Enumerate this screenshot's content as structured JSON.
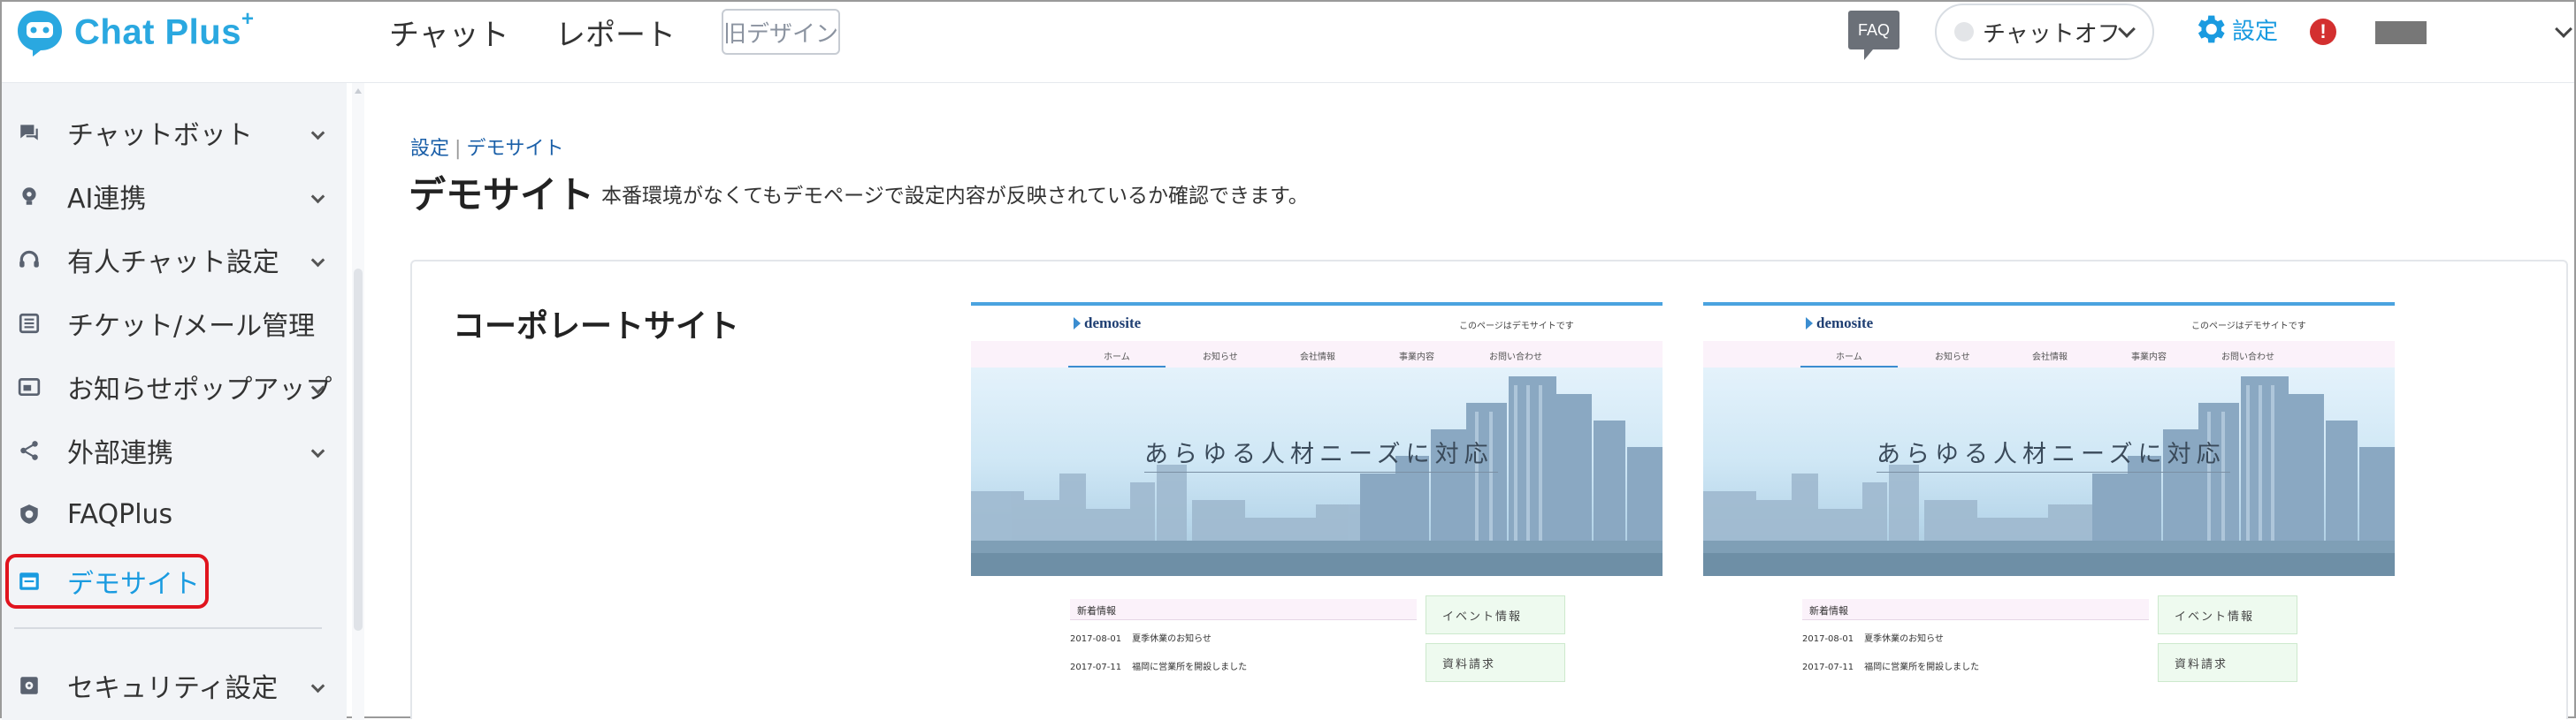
{
  "app": {
    "logo_text": "Chat Plus",
    "logo_sup": "+"
  },
  "topnav": {
    "items": [
      "チャット",
      "レポート"
    ],
    "old_design": "旧デザイン"
  },
  "header_right": {
    "faq_label": "FAQ",
    "chat_status": "チャットオフ",
    "settings_label": "設定",
    "alert_symbol": "!"
  },
  "sidebar": {
    "items": [
      {
        "label": "チャットボット",
        "icon": "chat-bubble-icon",
        "has_chevron": true
      },
      {
        "label": "AI連携",
        "icon": "lightbulb-icon",
        "has_chevron": true
      },
      {
        "label": "有人チャット設定",
        "icon": "headset-icon",
        "has_chevron": true
      },
      {
        "label": "チケット/メール管理",
        "icon": "ticket-list-icon",
        "has_chevron": false
      },
      {
        "label": "お知らせポップアップ",
        "icon": "popup-window-icon",
        "has_chevron": true
      },
      {
        "label": "外部連携",
        "icon": "share-icon",
        "has_chevron": true
      },
      {
        "label": "FAQPlus",
        "icon": "faq-shield-icon",
        "has_chevron": false
      },
      {
        "label": "デモサイト",
        "icon": "demo-site-icon",
        "has_chevron": false,
        "active": true
      },
      {
        "label": "セキュリティ設定",
        "icon": "lock-icon",
        "has_chevron": true
      }
    ]
  },
  "main": {
    "breadcrumb": [
      "設定",
      "デモサイト"
    ],
    "title": "デモサイト",
    "description": "本番環境がなくてもデモページで設定内容が反映されているか確認できます。",
    "card_title": "コーポレートサイト",
    "demo_thumbnail": {
      "logo": "demosite",
      "note": "このページはデモサイトです",
      "nav": [
        "ホーム",
        "お知らせ",
        "会社情報",
        "事業内容",
        "お問い合わせ"
      ],
      "hero_text": "あらゆる人材ニーズに対応",
      "news_title": "新着情報",
      "news": [
        {
          "date": "2017-08-01",
          "text": "夏季休業のお知らせ"
        },
        {
          "date": "2017-07-11",
          "text": "福岡に営業所を開設しました"
        }
      ],
      "banners": [
        "イベント情報",
        "資料請求"
      ]
    }
  },
  "colors": {
    "accent": "#1a9be0",
    "active_ring": "#e0141e",
    "alert": "#d32f2f"
  }
}
